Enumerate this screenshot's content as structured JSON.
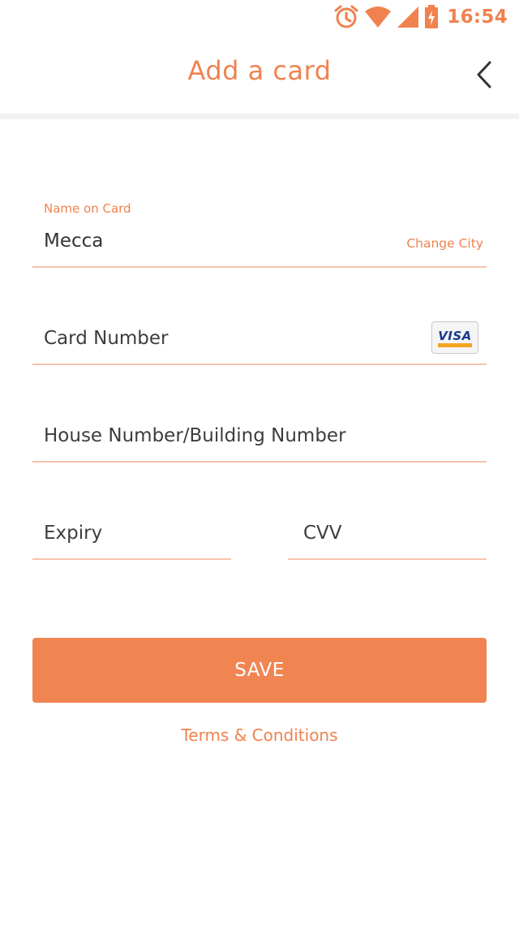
{
  "status_bar": {
    "time": "16:54",
    "icons": [
      "alarm-icon",
      "wifi-icon",
      "signal-icon",
      "battery-charging-icon"
    ]
  },
  "header": {
    "title": "Add a card",
    "back_icon": "chevron-left-icon"
  },
  "form": {
    "name_on_card": {
      "label": "Name on Card",
      "value": "Mecca",
      "action_label": "Change City"
    },
    "card_number": {
      "placeholder": "Card Number",
      "card_brand_icon": "visa-card-icon",
      "card_brand_text": "VISA"
    },
    "house_number": {
      "placeholder": "House Number/Building Number"
    },
    "expiry": {
      "placeholder": "Expiry"
    },
    "cvv": {
      "placeholder": "CVV"
    }
  },
  "actions": {
    "save_label": "SAVE",
    "terms_label": "Terms & Conditions"
  },
  "colors": {
    "accent": "#f0824f",
    "button": "#f08552",
    "underline": "#f8c3ac",
    "text": "#333333"
  }
}
